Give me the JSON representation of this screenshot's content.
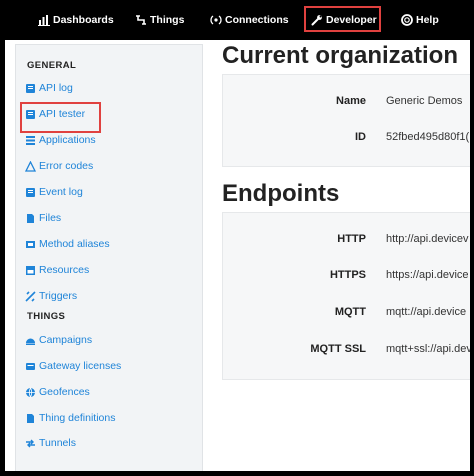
{
  "topnav": {
    "items": [
      {
        "label": "Dashboards",
        "icon": "dashboard-icon"
      },
      {
        "label": "Things",
        "icon": "things-icon"
      },
      {
        "label": "Connections",
        "icon": "connections-icon"
      },
      {
        "label": "Developer",
        "icon": "wrench-icon",
        "highlighted": true
      },
      {
        "label": "Help",
        "icon": "help-icon"
      }
    ]
  },
  "sidebar": {
    "general_heading": "GENERAL",
    "general_items": [
      {
        "label": "API log",
        "icon": "book-icon"
      },
      {
        "label": "API tester",
        "icon": "book-icon",
        "highlighted": true
      },
      {
        "label": "Applications",
        "icon": "applications-icon"
      },
      {
        "label": "Error codes",
        "icon": "warning-icon"
      },
      {
        "label": "Event log",
        "icon": "book-icon"
      },
      {
        "label": "Files",
        "icon": "file-icon"
      },
      {
        "label": "Method aliases",
        "icon": "method-icon"
      },
      {
        "label": "Resources",
        "icon": "resources-icon"
      },
      {
        "label": "Triggers",
        "icon": "triggers-icon"
      }
    ],
    "things_heading": "THINGS",
    "things_items": [
      {
        "label": "Campaigns",
        "icon": "campaigns-icon"
      },
      {
        "label": "Gateway licenses",
        "icon": "gateway-icon"
      },
      {
        "label": "Geofences",
        "icon": "globe-icon"
      },
      {
        "label": "Thing definitions",
        "icon": "file-icon"
      },
      {
        "label": "Tunnels",
        "icon": "tunnels-icon"
      }
    ]
  },
  "organization": {
    "title": "Current organization",
    "rows": [
      {
        "key": "Name",
        "value": "Generic Demos"
      },
      {
        "key": "ID",
        "value": "52fbed495d80f1("
      }
    ]
  },
  "endpoints": {
    "title": "Endpoints",
    "rows": [
      {
        "key": "HTTP",
        "value": "http://api.devicev"
      },
      {
        "key": "HTTPS",
        "value": "https://api.device"
      },
      {
        "key": "MQTT",
        "value": "mqtt://api.device"
      },
      {
        "key": "MQTT SSL",
        "value": "mqtt+ssl://api.dev"
      }
    ]
  },
  "colors": {
    "highlight": "#e0413f",
    "link": "#1f84d8"
  }
}
